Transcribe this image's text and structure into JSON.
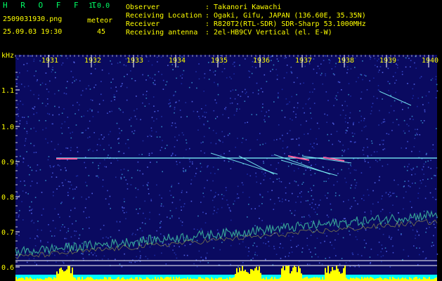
{
  "header": {
    "app_name": "H R O F F T",
    "version": "1.0.0",
    "filename": "2509031930.png",
    "datetime": "25.09.03 19:30",
    "meteor_label": "meteor",
    "meteor_count": "45",
    "info_labels": [
      "Observer",
      "Receiving Location",
      "Receiver",
      "Receiving antenna"
    ],
    "info_values": [
      ": Takanori Kawachi",
      ": Ogaki, Gifu, JAPAN (136.60E, 35.35N)",
      ": R820T2(RTL-SDR) SDR-Sharp 53.1000MHz",
      ": 2el-HB9CV Vertical (el. E-W)"
    ]
  },
  "chart_data": {
    "type": "heatmap",
    "title": "",
    "ylabel": "kHz",
    "yticks": [
      "1.1",
      "1.0",
      "0.9",
      "0.8",
      "0.7",
      "0.6"
    ],
    "xticks": [
      "1931",
      "1932",
      "1933",
      "1934",
      "1935",
      "1936",
      "1937",
      "1938",
      "1939",
      "1940"
    ],
    "colors": {
      "background": "#0a0a60",
      "noise": "#3040c0",
      "carrier": "#80ffff",
      "meteor": "#ff60a0",
      "tick_text": "#ffff00",
      "activity_bar": "#ffff00",
      "base_bar": "#00ffff"
    }
  }
}
